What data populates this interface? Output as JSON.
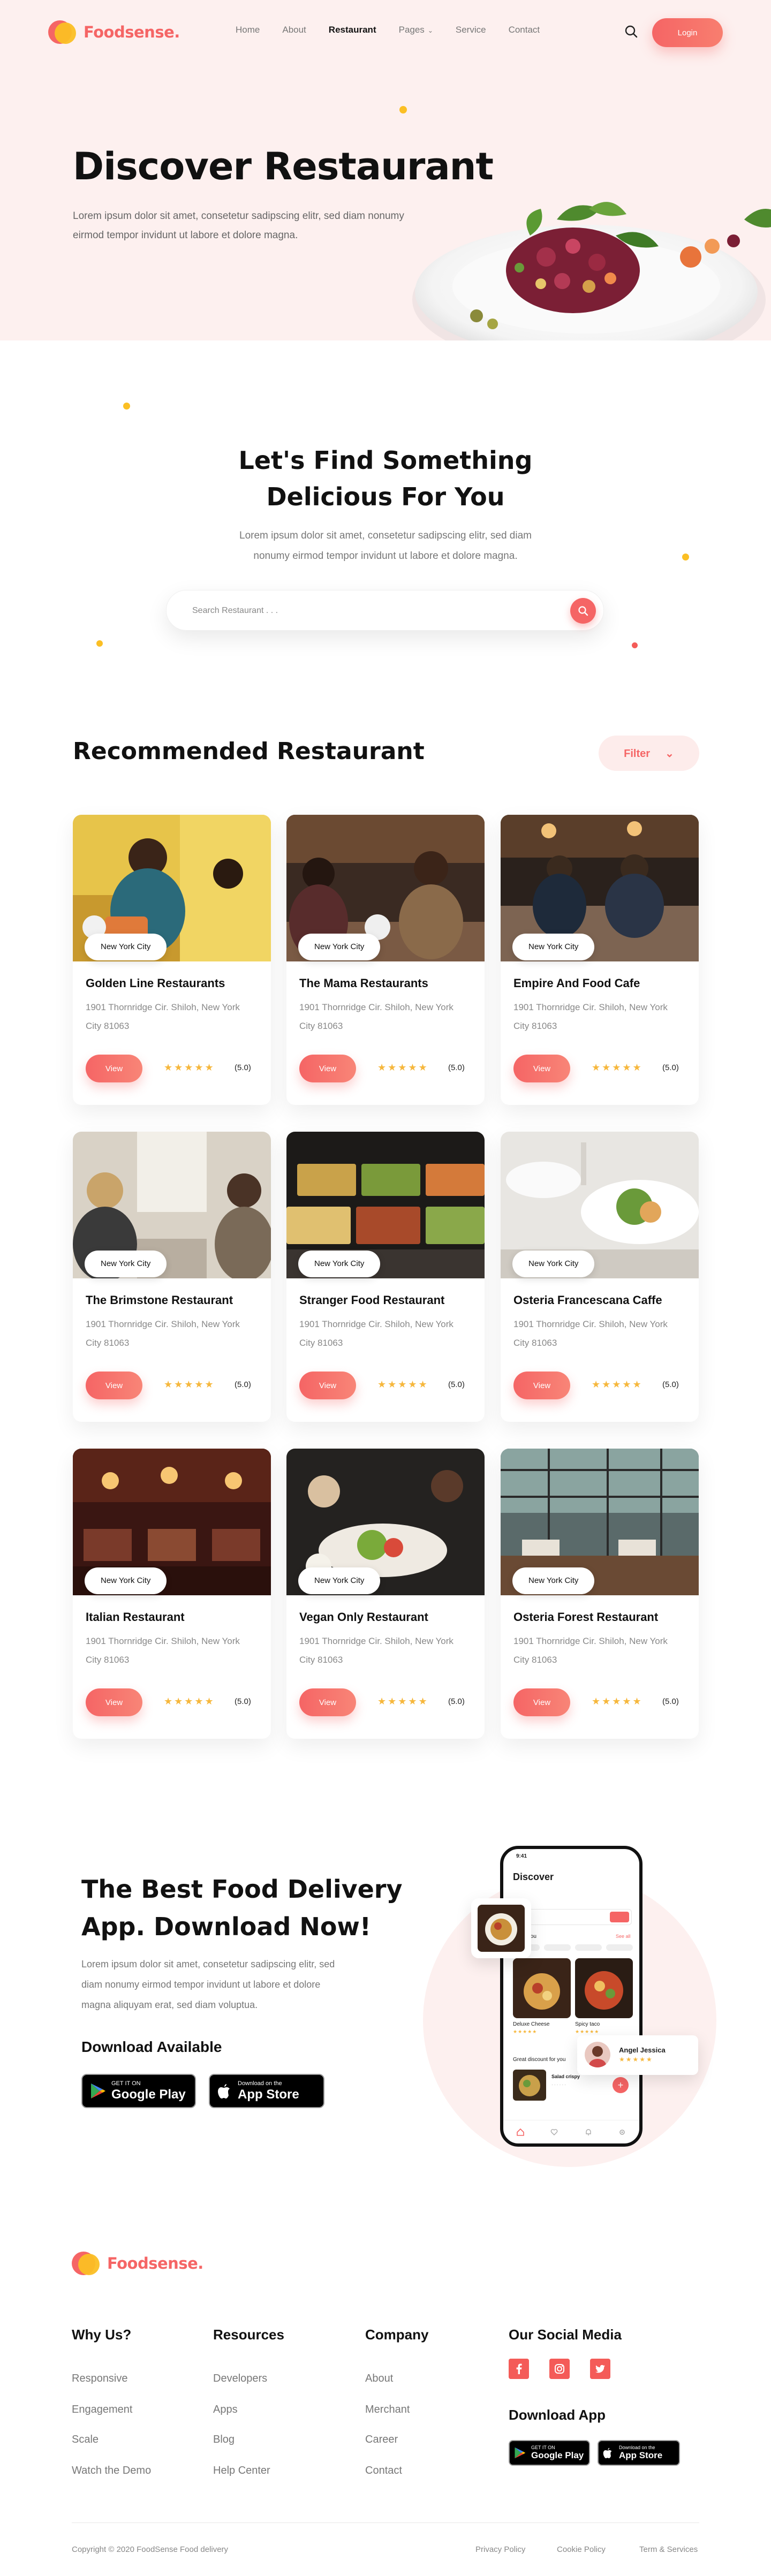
{
  "brand": {
    "name": "Foodsense.",
    "accent": "#f56565",
    "secondary": "#fbbf24"
  },
  "nav": {
    "items": [
      {
        "label": "Home"
      },
      {
        "label": "About"
      },
      {
        "label": "Restaurant",
        "active": true
      },
      {
        "label": "Pages",
        "has_dropdown": true
      },
      {
        "label": "Service"
      },
      {
        "label": "Contact"
      }
    ],
    "login_label": "Login",
    "search_icon": "search-icon"
  },
  "hero": {
    "title": "Discover Restaurant",
    "subtitle": "Lorem ipsum dolor sit amet, consetetur sadipscing elitr, sed diam nonumy eirmod tempor invidunt ut labore et dolore magna."
  },
  "find": {
    "title_line1": "Let's Find Something",
    "title_line2": "Delicious For You",
    "subtitle": "Lorem ipsum dolor sit amet, consetetur sadipscing elitr, sed diam nonumy eirmod tempor invidunt ut labore et dolore magna.",
    "search_placeholder": "Search Restaurant . . ."
  },
  "recommended": {
    "title": "Recommended Restaurant",
    "filter_label": "Filter",
    "cards": [
      {
        "city": "New York City",
        "name": "Golden Line Restaurants",
        "address": "1901 Thornridge Cir. Shiloh, New York City 81063",
        "view_label": "View",
        "rating": "(5.0)",
        "stars": 5
      },
      {
        "city": "New York City",
        "name": "The Mama Restaurants",
        "address": "1901 Thornridge Cir. Shiloh, New York City 81063",
        "view_label": "View",
        "rating": "(5.0)",
        "stars": 5
      },
      {
        "city": "New York City",
        "name": "Empire And Food Cafe",
        "address": "1901 Thornridge Cir. Shiloh, New York City 81063",
        "view_label": "View",
        "rating": "(5.0)",
        "stars": 5
      },
      {
        "city": "New York City",
        "name": "The Brimstone Restaurant",
        "address": "1901 Thornridge Cir. Shiloh, New York City 81063",
        "view_label": "View",
        "rating": "(5.0)",
        "stars": 5
      },
      {
        "city": "New York City",
        "name": "Stranger Food Restaurant",
        "address": "1901 Thornridge Cir. Shiloh, New York City 81063",
        "view_label": "View",
        "rating": "(5.0)",
        "stars": 5
      },
      {
        "city": "New York City",
        "name": "Osteria Francescana Caffe",
        "address": "1901 Thornridge Cir. Shiloh, New York City 81063",
        "view_label": "View",
        "rating": "(5.0)",
        "stars": 5
      },
      {
        "city": "New York City",
        "name": "Italian Restaurant",
        "address": "1901 Thornridge Cir. Shiloh, New York City 81063",
        "view_label": "View",
        "rating": "(5.0)",
        "stars": 5
      },
      {
        "city": "New York City",
        "name": "Vegan Only Restaurant",
        "address": "1901 Thornridge Cir. Shiloh, New York City 81063",
        "view_label": "View",
        "rating": "(5.0)",
        "stars": 5
      },
      {
        "city": "New York City",
        "name": "Osteria Forest Restaurant",
        "address": "1901 Thornridge Cir. Shiloh, New York City 81063",
        "view_label": "View",
        "rating": "(5.0)",
        "stars": 5
      }
    ]
  },
  "app": {
    "title_line1": "The Best Food Delivery",
    "title_line2": "App. Download Now!",
    "subtitle": "Lorem ipsum dolor sit amet, consetetur sadipscing elitr, sed diam nonumy eirmod tempor invidunt ut labore et dolore magna aliquyam erat, sed diam voluptua.",
    "download_label": "Download Available",
    "google_small": "GET IT ON",
    "google_big": "Google Play",
    "apple_small": "Download on the",
    "apple_big": "App Store",
    "phone": {
      "time": "9:41",
      "title": "Discover",
      "row_label": "dy for you",
      "see_all": "See all",
      "item1_label": "Deluxe Cheese",
      "item2_label": "Spicy taco",
      "discount_label": "Great discount for you",
      "deal_title": "Salad crispy",
      "reviewer_name": "Angel Jessica"
    }
  },
  "footer": {
    "logo": "Foodsense.",
    "columns": [
      {
        "title": "Why Us?",
        "links": [
          "Responsive",
          "Engagement",
          "Scale",
          "Watch the Demo"
        ]
      },
      {
        "title": "Resources",
        "links": [
          "Developers",
          "Apps",
          "Blog",
          "Help Center"
        ]
      },
      {
        "title": "Company",
        "links": [
          "About",
          "Merchant",
          "Career",
          "Contact"
        ]
      }
    ],
    "social_title": "Our Social Media",
    "social_icons": [
      "facebook-icon",
      "instagram-icon",
      "twitter-icon"
    ],
    "download_title": "Download App",
    "copyright": "Copyright © 2020 FoodSense Food delivery",
    "policies": [
      "Privacy Policy",
      "Cookie Policy",
      "Term & Services"
    ]
  }
}
